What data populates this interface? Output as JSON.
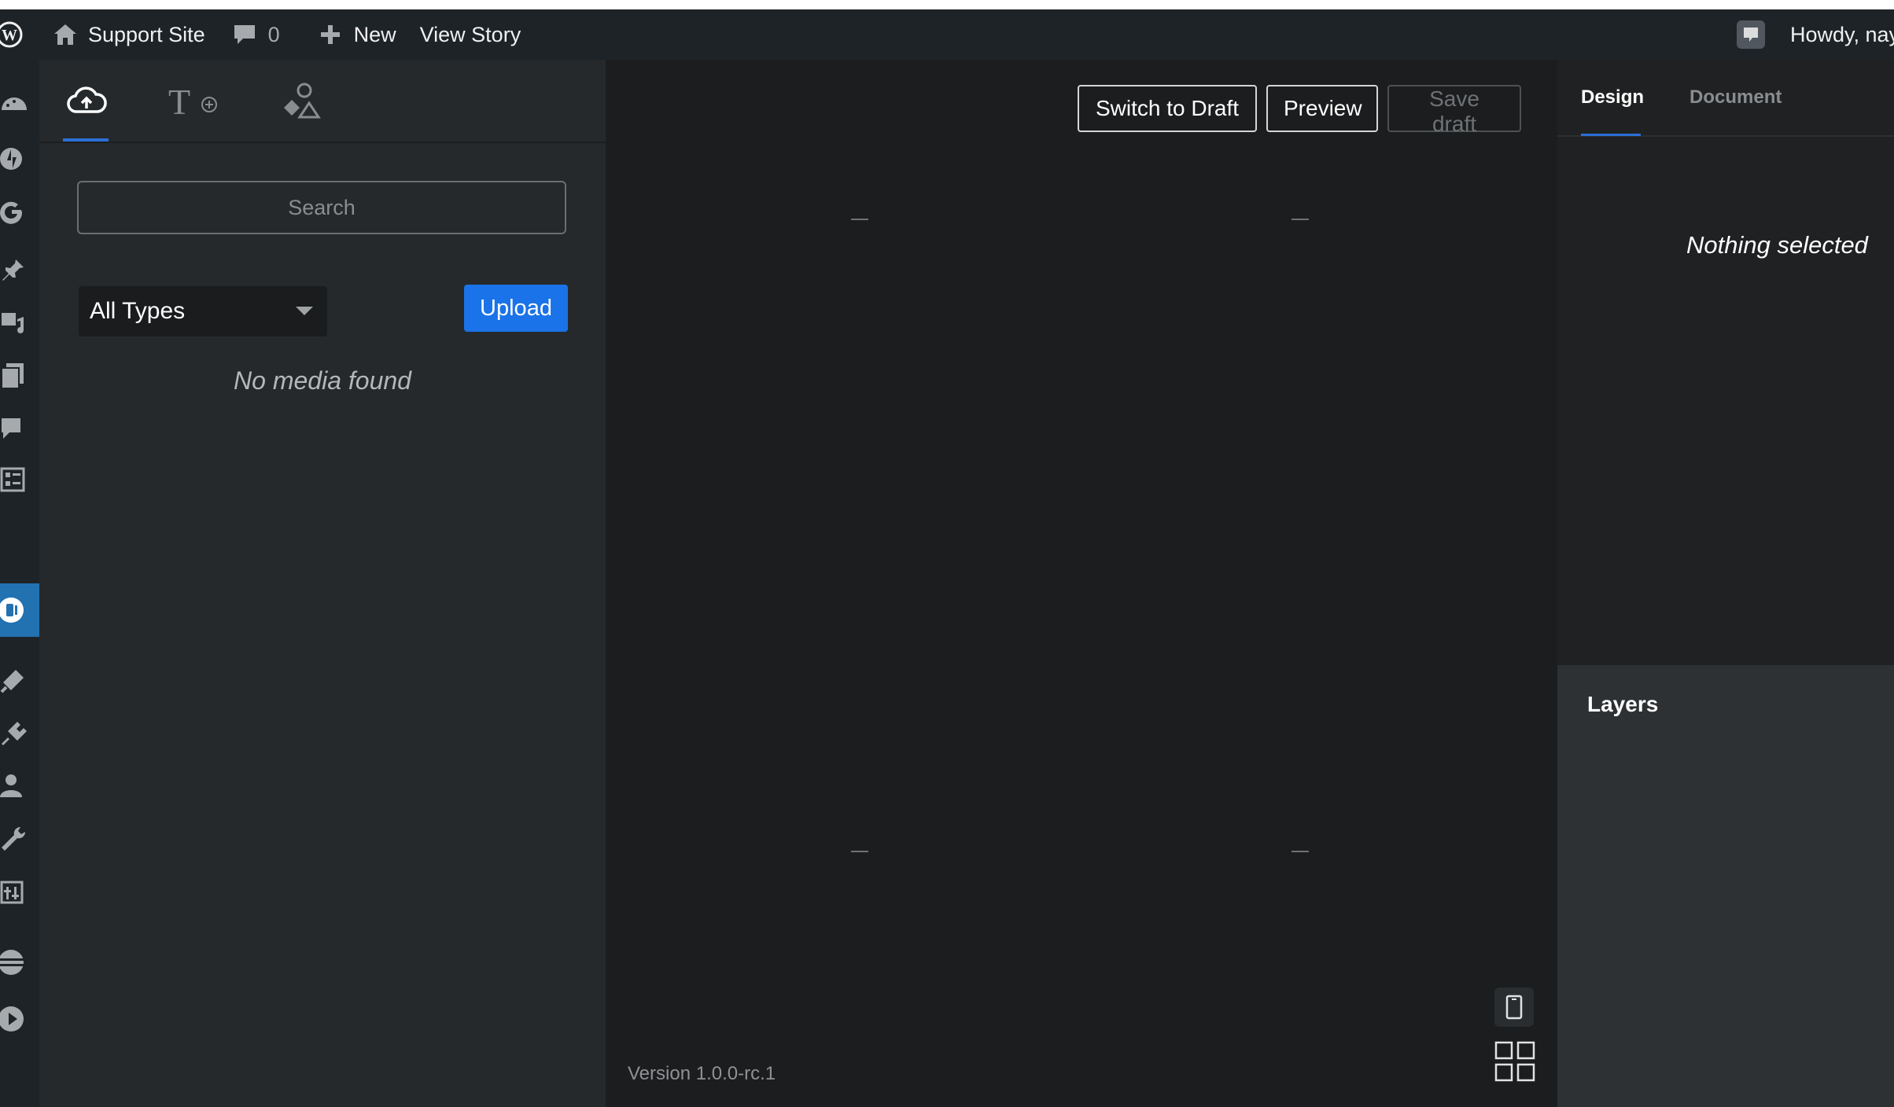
{
  "admin_bar": {
    "site_name": "Support Site",
    "comments_count": "0",
    "new_label": "New",
    "view_story_label": "View Story",
    "howdy_label": "Howdy, nay"
  },
  "wp_nav": {
    "icons": [
      "dashboard-icon",
      "jetpack-icon",
      "google-icon",
      "pin-icon",
      "media-icon",
      "pages-icon",
      "comments-icon",
      "forms-icon",
      "stories-icon",
      "appearance-icon",
      "plugins-icon",
      "users-icon",
      "tools-icon",
      "settings-icon",
      "web-stories-icon",
      "play-icon"
    ],
    "active": "stories-icon"
  },
  "library": {
    "tabs": [
      "upload-icon",
      "text-icon",
      "shapes-icon"
    ],
    "search_placeholder": "Search",
    "type_filter": "All Types",
    "upload_label": "Upload",
    "empty_message": "No media found"
  },
  "canvas": {
    "switch_to_draft": "Switch to Draft",
    "preview": "Preview",
    "save_draft": "Save draft",
    "version": "Version 1.0.0-rc.1"
  },
  "inspector": {
    "tab_design": "Design",
    "tab_document": "Document",
    "nothing_selected": "Nothing selected",
    "layers_title": "Layers"
  },
  "colors": {
    "accent": "#1a73e8",
    "admin_bar": "#1d2327",
    "active_nav": "#2271b1"
  }
}
